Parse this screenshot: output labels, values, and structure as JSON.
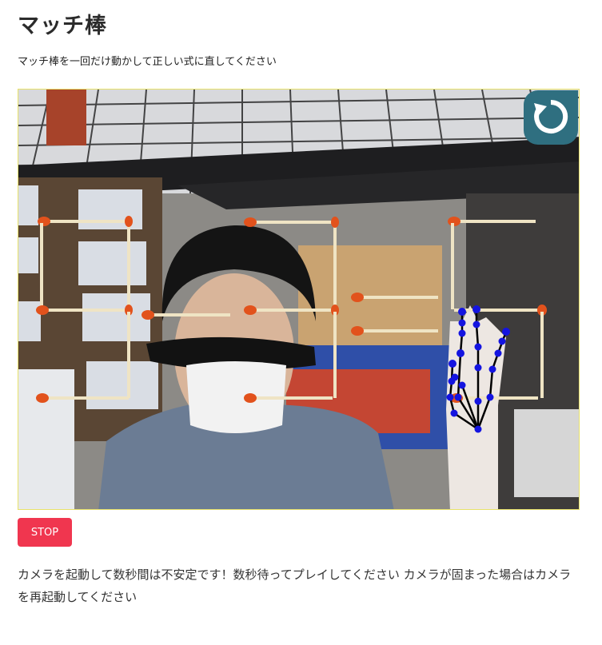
{
  "page": {
    "title": "マッチ棒",
    "instruction": "マッチ棒を一回だけ動かして正しい式に直してください"
  },
  "camera": {
    "feed_label": "camera-feed",
    "reset_icon": "refresh-icon",
    "reset_color": "#2f6f80"
  },
  "controls": {
    "stop_label": "STOP",
    "stop_color": "#f0364f"
  },
  "notice": {
    "text": "カメラを起動して数秒間は不安定です！数秒待ってプレイしてください カメラが固まった場合はカメラを再起動してください"
  },
  "colors": {
    "match_head": "#e2521c",
    "match_stick": "#efe4c4",
    "hand_point": "#1414e0",
    "hand_line": "#000000"
  }
}
